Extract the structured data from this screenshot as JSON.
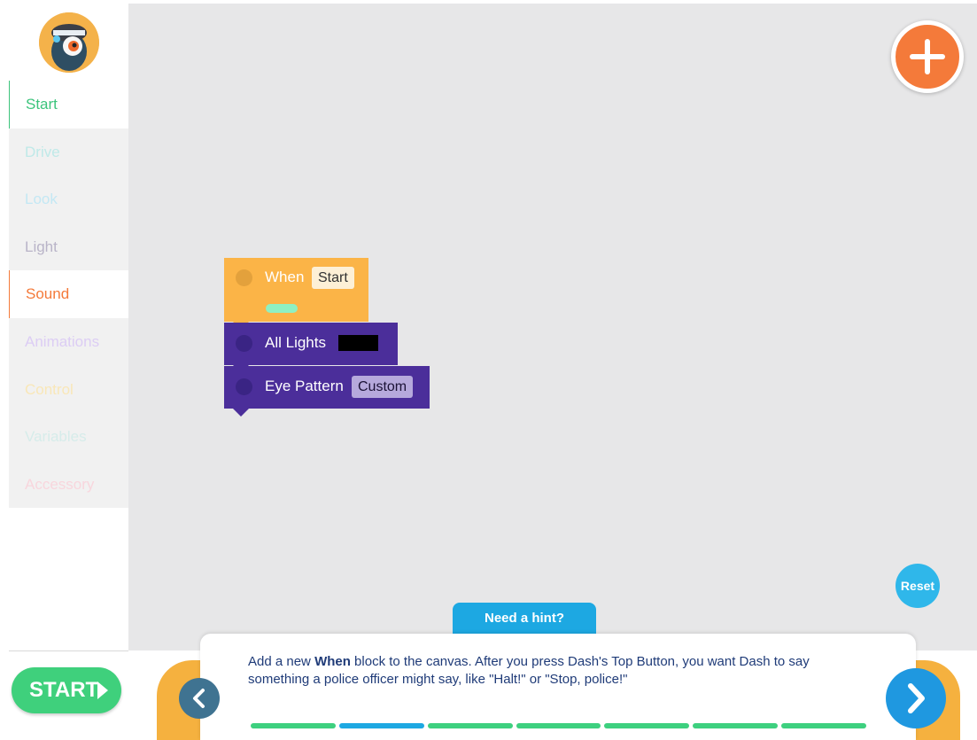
{
  "sidebar": {
    "avatar_name": "dash-robot-avatar",
    "items": [
      {
        "label": "Start",
        "color": "#3cc47c"
      },
      {
        "label": "Drive",
        "color": "#bfe9e8"
      },
      {
        "label": "Look",
        "color": "#c3e8f4"
      },
      {
        "label": "Light",
        "color": "#b9b4c8"
      },
      {
        "label": "Sound",
        "color": "#f47a3a"
      },
      {
        "label": "Animations",
        "color": "#dccdf4"
      },
      {
        "label": "Control",
        "color": "#f9e7b8"
      },
      {
        "label": "Variables",
        "color": "#d6ecea"
      },
      {
        "label": "Accessory",
        "color": "#f8d6dd"
      }
    ]
  },
  "canvas": {
    "blocks": {
      "when": {
        "label": "When",
        "value": "Start"
      },
      "lights": {
        "label": "All Lights"
      },
      "eye": {
        "label": "Eye Pattern",
        "value": "Custom"
      }
    },
    "reset_label": "Reset",
    "add_icon": "plus-icon"
  },
  "hint": {
    "label": "Need a hint?"
  },
  "instructions": {
    "before": "Add a new ",
    "bold": "When",
    "after": " block to the canvas. After you press Dash's Top Button, you want Dash to say something a police officer might say, like \"Halt!\" or \"Stop, police!\""
  },
  "progress": {
    "total_steps": 7,
    "current_step": 2,
    "colors": {
      "done": "#3dd07f",
      "current": "#1da8e2"
    }
  },
  "start_button": {
    "label": "START"
  }
}
